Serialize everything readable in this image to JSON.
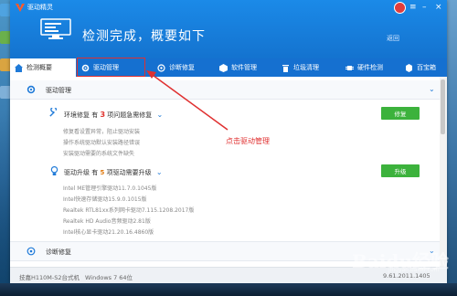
{
  "window": {
    "app_name": "驱动精灵",
    "headline": "检测完成，概要如下",
    "rescan_label": "返回"
  },
  "tabs": [
    {
      "label": "检测概要",
      "icon": "home-icon"
    },
    {
      "label": "驱动管理",
      "icon": "gear-icon"
    },
    {
      "label": "诊断修复",
      "icon": "target-icon"
    },
    {
      "label": "软件管理",
      "icon": "package-icon"
    },
    {
      "label": "垃圾清理",
      "icon": "trash-icon"
    },
    {
      "label": "硬件检测",
      "icon": "chip-icon"
    },
    {
      "label": "百宝箱",
      "icon": "box-icon"
    }
  ],
  "driver_section": {
    "title": "驱动管理",
    "env": {
      "prefix": "环境修复",
      "mid1": "有",
      "count": "3",
      "suffix": "项问题急需修复",
      "button": "修复",
      "items": [
        "修复看设置异常，阻止驱动安装",
        "操作系统驱动默认安装路径错误",
        "安装驱动需要的系统文件缺失"
      ]
    },
    "upgrade": {
      "prefix": "驱动升级",
      "mid1": "有",
      "count": "5",
      "suffix": "项驱动需要升级",
      "button": "升级",
      "items": [
        "Intel ME管理引擎驱动11.7.0.1045版",
        "Intel快速存储驱动15.9.0.1015版",
        "Realtek RTL81xx系列网卡驱动7.115.1208.2017版",
        "Realtek HD Audio音频驱动2.81版",
        "Intel核心显卡驱动21.20.16.4860版"
      ]
    }
  },
  "diag_section": {
    "title": "诊断修复"
  },
  "annotation": "点击驱动管理",
  "status": {
    "machine": "技嘉H110M-S2台式机",
    "os": "Windows 7 64位",
    "version": "9.61.2011.1405"
  },
  "watermark": {
    "text": "Baidu经验",
    "sub": "jingyan.baidu.com"
  },
  "colors": {
    "title_bar": "#1473cf",
    "accent": "#1f7ad8",
    "button": "#3cb23c",
    "alert": "#e0332e"
  }
}
